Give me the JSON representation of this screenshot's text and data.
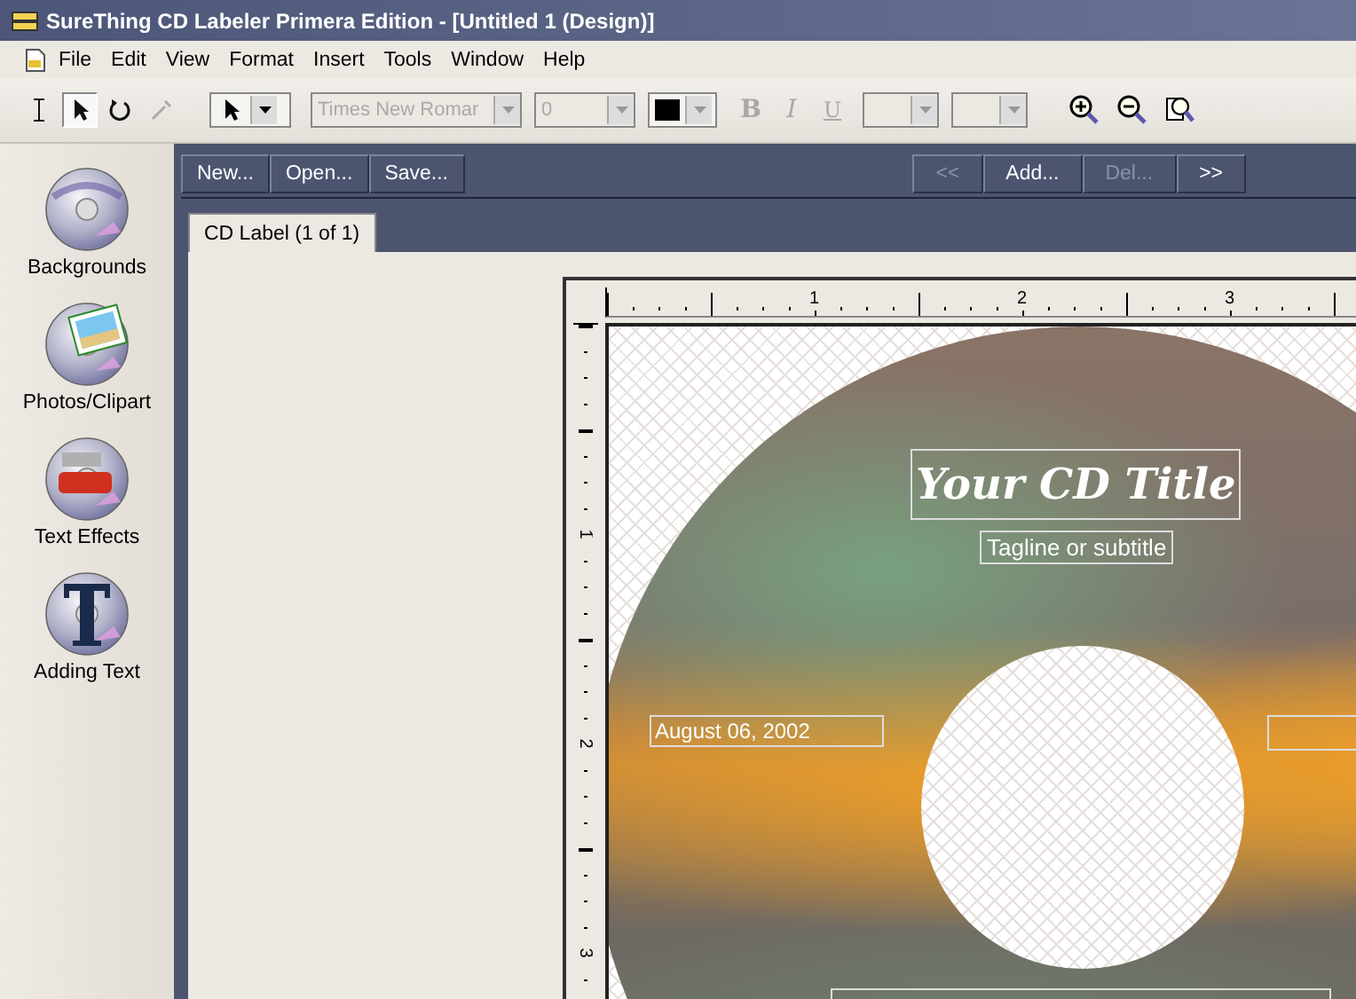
{
  "window": {
    "title": "SureThing CD Labeler Primera Edition - [Untitled 1 (Design)]"
  },
  "menu": [
    "File",
    "Edit",
    "View",
    "Format",
    "Insert",
    "Tools",
    "Window",
    "Help"
  ],
  "tools": [
    {
      "kind": "text",
      "selected": false,
      "disabled": false
    },
    {
      "kind": "pointer",
      "selected": true,
      "disabled": false
    },
    {
      "kind": "rotate",
      "selected": false,
      "disabled": false
    },
    {
      "kind": "eyedropper",
      "selected": false,
      "disabled": true
    }
  ],
  "font": {
    "value": "Times New Romar",
    "disabled": true
  },
  "size": {
    "value": "0",
    "disabled": true
  },
  "format_buttons": [
    {
      "label": "B",
      "kind": "bold",
      "disabled": true
    },
    {
      "label": "I",
      "kind": "italic",
      "disabled": true
    },
    {
      "label": "U",
      "kind": "underline",
      "disabled": true
    }
  ],
  "sidebar": {
    "items": [
      {
        "label": "Backgrounds",
        "kind": "backgrounds"
      },
      {
        "label": "Photos/Clipart",
        "kind": "photos"
      },
      {
        "label": "Text Effects",
        "kind": "effects"
      },
      {
        "label": "Adding Text",
        "kind": "text"
      }
    ]
  },
  "file_buttons": [
    {
      "label": "New...",
      "disabled": false
    },
    {
      "label": "Open...",
      "disabled": false
    },
    {
      "label": "Save...",
      "disabled": false
    }
  ],
  "page_buttons": [
    {
      "label": "<<",
      "disabled": true
    },
    {
      "label": "Add...",
      "disabled": false
    },
    {
      "label": "Del...",
      "disabled": true
    },
    {
      "label": ">>",
      "disabled": false
    }
  ],
  "tabs": [
    {
      "label": "CD Label (1 of 1)",
      "selected": true
    }
  ],
  "rulers": {
    "horizontal": [
      "1",
      "2",
      "3"
    ],
    "vertical": [
      "1",
      "2",
      "3"
    ]
  },
  "label": {
    "title": "Your CD Title",
    "subtitle": "Tagline or subtitle",
    "date": "August 06, 2002"
  }
}
